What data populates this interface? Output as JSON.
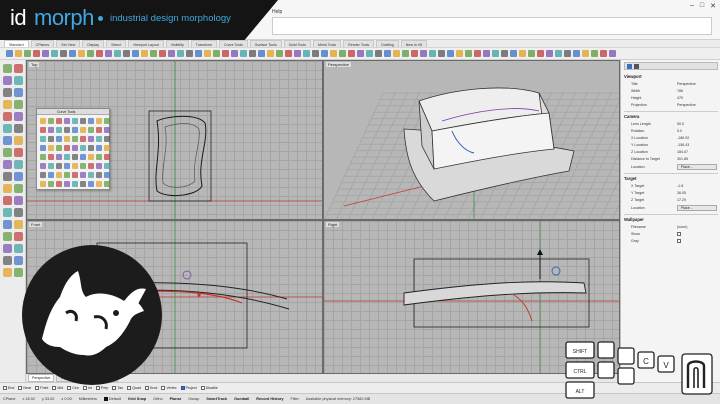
{
  "brand": {
    "id_text": "id",
    "morph_text": "morph",
    "tagline": "industrial design morphology",
    "accent": "#3fa8e0"
  },
  "menu": {
    "help": "Help"
  },
  "tabs": [
    "Standard",
    "CPlanes",
    "Set View",
    "Display",
    "Select",
    "Viewport Layout",
    "Visibility",
    "Transform",
    "Curve Tools",
    "Surface Tools",
    "Solid Tools",
    "Mesh Tools",
    "Render Tools",
    "Drafting",
    "New in V6"
  ],
  "viewports": {
    "top": "Top",
    "perspective": "Perspective",
    "front": "Front",
    "right": "Right"
  },
  "palette": {
    "title": "Curve Tools"
  },
  "properties": {
    "viewport_header": "Viewport",
    "rows_viewport": [
      {
        "label": "Title",
        "value": "Perspective"
      },
      {
        "label": "Width",
        "value": "786"
      },
      {
        "label": "Height",
        "value": "470"
      },
      {
        "label": "Projection",
        "value": "Perspective"
      }
    ],
    "camera_header": "Camera",
    "rows_camera": [
      {
        "label": "Lens Length",
        "value": "50.0"
      },
      {
        "label": "Rotation",
        "value": "0.0"
      },
      {
        "label": "X Location",
        "value": "-186.92"
      },
      {
        "label": "Y Location",
        "value": "-156.43"
      },
      {
        "label": "Z Location",
        "value": "184.07"
      },
      {
        "label": "Distance to Target",
        "value": "301.85"
      }
    ],
    "location_label": "Location",
    "place_button": "Place...",
    "target_header": "Target",
    "rows_target": [
      {
        "label": "X Target",
        "value": "-1.8"
      },
      {
        "label": "Y Target",
        "value": "36.05"
      },
      {
        "label": "Z Target",
        "value": "17.29"
      }
    ],
    "wallpaper_header": "Wallpaper",
    "rows_wallpaper": [
      {
        "label": "Filename",
        "value": "(none)"
      },
      {
        "label": "Show",
        "value": ""
      },
      {
        "label": "Gray",
        "value": ""
      }
    ]
  },
  "viewport_tabs": [
    "Perspective",
    "Top",
    "Front",
    "Right"
  ],
  "osnaps": [
    {
      "label": "End",
      "on": false
    },
    {
      "label": "Near",
      "on": false
    },
    {
      "label": "Point",
      "on": false
    },
    {
      "label": "Mid",
      "on": false
    },
    {
      "label": "Cen",
      "on": false
    },
    {
      "label": "Int",
      "on": false
    },
    {
      "label": "Perp",
      "on": false
    },
    {
      "label": "Tan",
      "on": false
    },
    {
      "label": "Quad",
      "on": false
    },
    {
      "label": "Knot",
      "on": false
    },
    {
      "label": "Vertex",
      "on": false
    },
    {
      "label": "Project",
      "on": true
    },
    {
      "label": "Disable",
      "on": false
    }
  ],
  "status": {
    "cplane": "CPlane",
    "x": "x 18.92",
    "y": "y 33.02",
    "z": "z 0.00",
    "units": "Millimeters",
    "layer": "Default",
    "grid_snap": "Grid Snap",
    "ortho": "Ortho",
    "planar": "Planar",
    "osnap": "Osnap",
    "smarttrack": "SmartTrack",
    "gumball": "Gumball",
    "record_history": "Record History",
    "filter": "Filter",
    "memory": "Available physical memory: 27582 MB"
  },
  "keycaps": [
    "SHIFT",
    "CTRL",
    "ALT",
    "C",
    "V"
  ],
  "colors": {
    "viewport_bg": "#b7b7b7",
    "grid": "#a5a5a5",
    "axis_red": "#c0392b",
    "axis_green": "#2e8b3a"
  }
}
